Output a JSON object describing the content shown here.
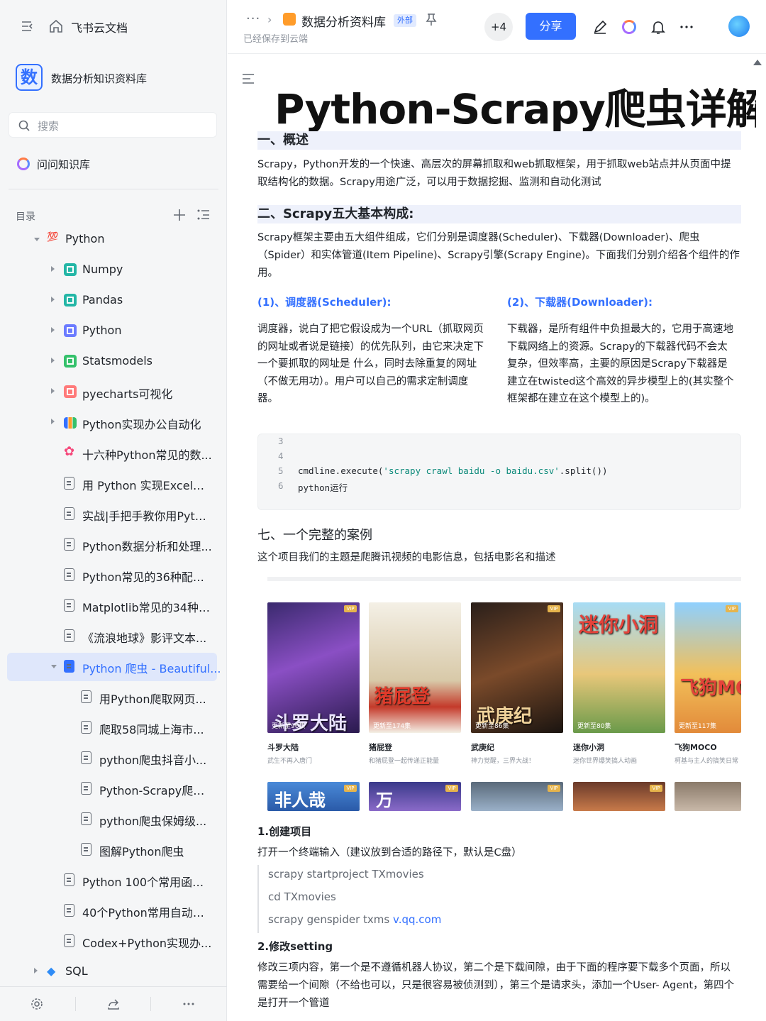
{
  "sidebar": {
    "brand": "飞书云文档",
    "kb_logo": "数",
    "kb_name": "数据分析知识资料库",
    "search_placeholder": "搜索",
    "ask_label": "问问知识库",
    "toc_label": "目录",
    "items": [
      {
        "label": "Python",
        "icon": "hundred-emoji-icon"
      },
      {
        "label": "Numpy",
        "icon": "image-icon"
      },
      {
        "label": "Pandas",
        "icon": "image-icon"
      },
      {
        "label": "Python",
        "icon": "image-icon"
      },
      {
        "label": "Statsmodels",
        "icon": "table-icon"
      },
      {
        "label": "pyecharts可视化",
        "icon": "image-icon"
      },
      {
        "label": "Python实现办公自动化",
        "icon": "bar-chart-icon"
      },
      {
        "label": "十六种Python常见的数...",
        "icon": "flower-icon"
      },
      {
        "label": "用 Python 实现Excel报...",
        "icon": "doc-icon"
      },
      {
        "label": "实战|手把手教你用Pyth...",
        "icon": "doc-icon"
      },
      {
        "label": "Python数据分析和处理...",
        "icon": "doc-icon"
      },
      {
        "label": "Python常见的36种配图...",
        "icon": "doc-icon"
      },
      {
        "label": "Matplotlib常见的34种配...",
        "icon": "doc-icon"
      },
      {
        "label": "《流浪地球》影评文本...",
        "icon": "doc-icon"
      },
      {
        "label": "Python 爬虫 - Beautiful...",
        "icon": "doc-icon"
      },
      {
        "label": "用Python爬取网页...",
        "icon": "doc-icon"
      },
      {
        "label": "爬取58同城上海市...",
        "icon": "doc-icon"
      },
      {
        "label": "python爬虫抖音小...",
        "icon": "doc-icon"
      },
      {
        "label": "Python-Scrapy爬虫...",
        "icon": "doc-icon"
      },
      {
        "label": "python爬虫保姆级...",
        "icon": "doc-icon"
      },
      {
        "label": "图解Python爬虫",
        "icon": "doc-icon"
      },
      {
        "label": "Python 100个常用函数...",
        "icon": "doc-icon"
      },
      {
        "label": "40个Python常用自动化...",
        "icon": "doc-icon"
      },
      {
        "label": "Codex+Python实现办...",
        "icon": "doc-icon"
      },
      {
        "label": "SQL",
        "icon": "diamond-icon"
      }
    ]
  },
  "header": {
    "dots": "···",
    "breadcrumb": "数据分析资料库",
    "tag": "外部",
    "saved": "已经保存到云端",
    "collaborators": "+4",
    "share": "分享"
  },
  "doc": {
    "title": "Python-Scrapy爬虫详解",
    "h_overview": "一、概述",
    "overview": "Scrapy，Python开发的一个快速、高层次的屏幕抓取和web抓取框架，用于抓取web站点并从页面中提取结构化的数据。Scrapy用途广泛，可以用于数据挖掘、监测和自动化测试",
    "h_components": "二、Scrapy五大基本构成:",
    "components": "Scrapy框架主要由五大组件组成，它们分别是调度器(Scheduler)、下载器(Downloader)、爬虫（Spider）和实体管道(Item Pipeline)、Scrapy引擎(Scrapy Engine)。下面我们分别介绍各个组件的作用。",
    "sub1": "(1)、调度器(Scheduler):",
    "sub1_text": "调度器，说白了把它假设成为一个URL（抓取网页的网址或者说是链接）的优先队列，由它来决定下一个要抓取的网址是 什么，同时去除重复的网址（不做无用功）。用户可以自己的需求定制调度器。",
    "sub2": "(2)、下载器(Downloader):",
    "sub2_text": "下载器，是所有组件中负担最大的，它用于高速地下载网络上的资源。Scrapy的下载器代码不会太复杂，但效率高，主要的原因是Scrapy下载器是建立在twisted这个高效的异步模型上的(其实整个框架都在建立在这个模型上的)。",
    "code": {
      "lines": [
        "3",
        "4",
        "5",
        "6"
      ],
      "line5_pre": "cmdline.execute(",
      "line5_str": "'scrapy crawl baidu -o baidu.csv'",
      "line5_post": ".split())",
      "line6": "python运行"
    },
    "h_case": "七、一个完整的案例",
    "case_text": "这个项目我们的主题是爬腾讯视频的电影信息，包括电影名和描述",
    "movies": [
      {
        "name": "斗罗大陆",
        "desc": "武生不再入唐门",
        "ep": "更新至96集",
        "poster_text": "斗罗大陆"
      },
      {
        "name": "猪屁登",
        "desc": "和猪屁登一起传递正能量",
        "ep": "更新至174集",
        "poster_text": "猪屁登"
      },
      {
        "name": "武庚纪",
        "desc": "神力觉醒，三界大战！",
        "ep": "更新至86集",
        "poster_text": "武庚纪"
      },
      {
        "name": "迷你小洞",
        "desc": "迷你世界爆笑搞人动画",
        "ep": "更新至80集",
        "poster_text": "迷你小洞"
      },
      {
        "name": "飞狗MOCO",
        "desc": "柯基与主人的搞笑日常",
        "ep": "更新至117集",
        "poster_text": "飞狗MOCO"
      }
    ],
    "thumbs": [
      "非人哉",
      "万",
      "",
      "",
      ""
    ],
    "step1": "1.创建项目",
    "step1_text": "打开一个终端输入（建议放到合适的路径下，默认是C盘）",
    "cmd1": "scrapy startproject TXmovies",
    "cmd2": "cd TXmovies",
    "cmd3_pre": "scrapy genspider txms ",
    "cmd3_link": "v.qq.com",
    "step2": "2.修改setting",
    "step2_text": "修改三项内容，第一个是不遵循机器人协议，第二个是下载间隙，由于下面的程序要下载多个页面，所以需要给一个间隙（不给也可以，只是很容易被侦测到），第三个是请求头，添加一个User- Agent，第四个是打开一个管道"
  },
  "colors": {
    "accent": "#3370ff",
    "sidebar_bg": "#f5f6f7",
    "active_bg": "#dfe7fb"
  }
}
